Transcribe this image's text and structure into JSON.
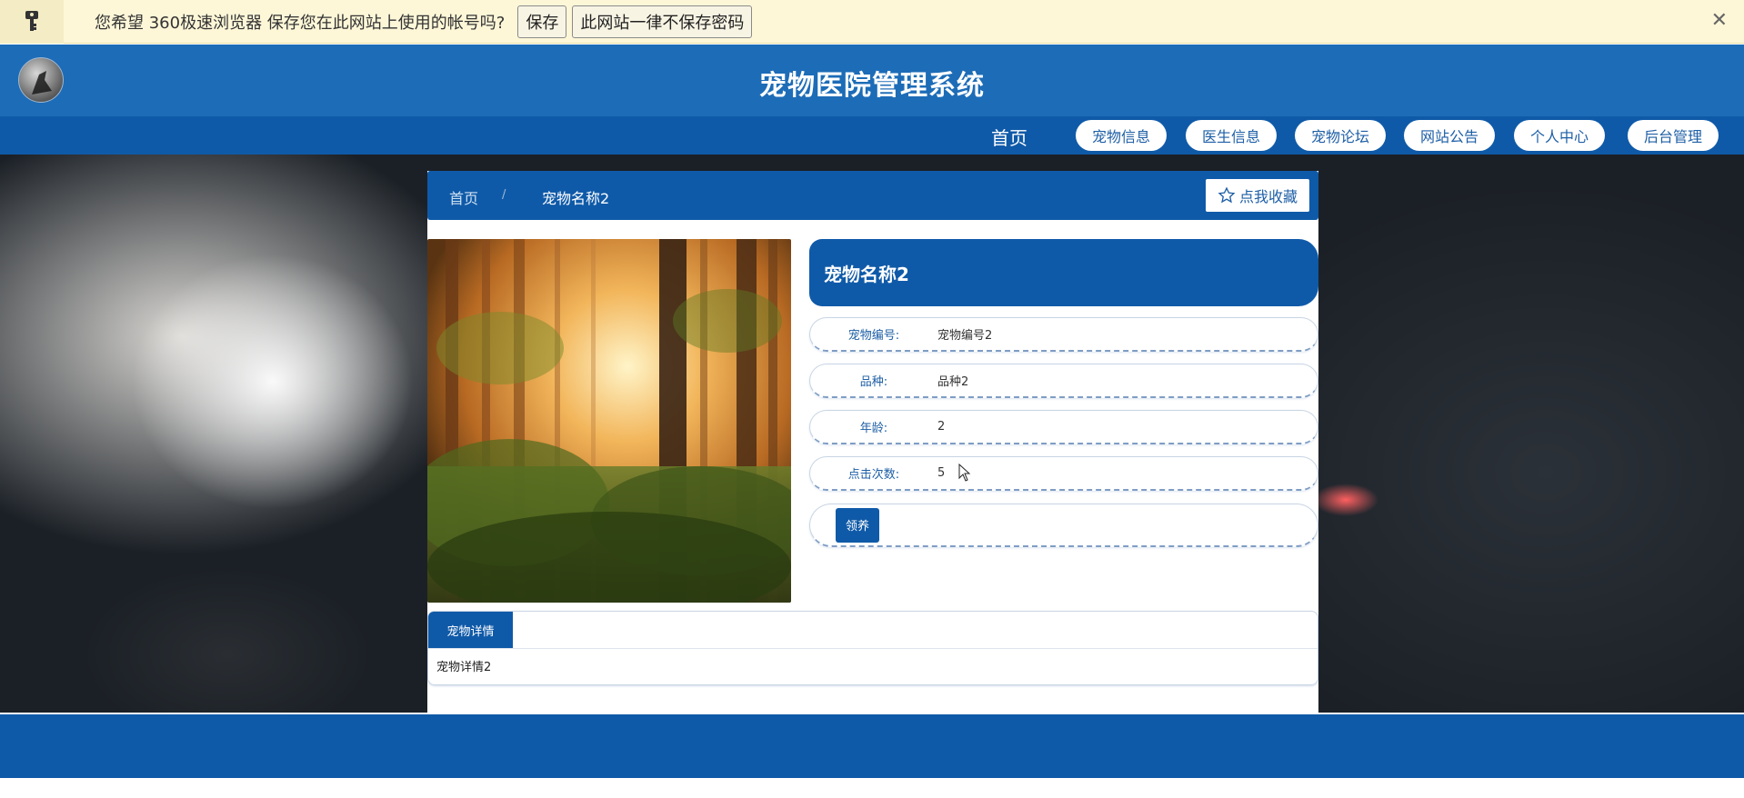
{
  "password_bar": {
    "message": "您希望 360极速浏览器 保存您在此网站上使用的帐号吗?",
    "save_label": "保存",
    "never_label": "此网站一律不保存密码",
    "close_glyph": "✕"
  },
  "header": {
    "title": "宠物医院管理系统"
  },
  "nav": {
    "home_label": "首页",
    "items": [
      {
        "label": "宠物信息"
      },
      {
        "label": "医生信息"
      },
      {
        "label": "宠物论坛"
      },
      {
        "label": "网站公告"
      },
      {
        "label": "个人中心"
      },
      {
        "label": "后台管理"
      }
    ]
  },
  "breadcrumb": {
    "home": "首页",
    "separator": "/",
    "current": "宠物名称2",
    "favorite_label": "点我收藏"
  },
  "pet": {
    "name": "宠物名称2",
    "fields": [
      {
        "label": "宠物编号:",
        "value": "宠物编号2"
      },
      {
        "label": "品种:",
        "value": "品种2"
      },
      {
        "label": "年龄:",
        "value": "2"
      },
      {
        "label": "点击次数:",
        "value": "5"
      }
    ],
    "adopt_label": "领养"
  },
  "details": {
    "tab_label": "宠物详情",
    "content": "宠物详情2"
  },
  "colors": {
    "primary": "#0f5aa8",
    "header": "#1d6cb7",
    "password_bar": "#fdf7d8"
  },
  "icons": {
    "key": "key-icon",
    "close": "close-icon",
    "star": "star-icon",
    "logo": "logo-avatar"
  }
}
